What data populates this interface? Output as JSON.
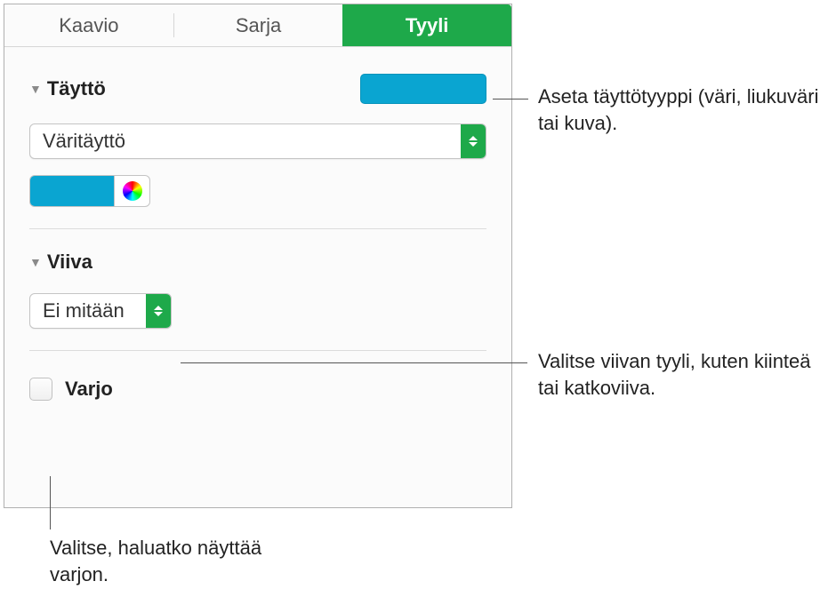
{
  "tabs": {
    "chart": "Kaavio",
    "series": "Sarja",
    "style": "Tyyli"
  },
  "fill": {
    "title": "Täyttö",
    "select_value": "Väritäyttö",
    "swatch_color": "#0aa5d1"
  },
  "line": {
    "title": "Viiva",
    "select_value": "Ei mitään"
  },
  "shadow": {
    "label": "Varjo"
  },
  "callouts": {
    "fill_type": "Aseta täyttötyyppi (väri, liukuväri tai kuva).",
    "line_style": "Valitse viivan tyyli, kuten kiinteä tai katkoviiva.",
    "shadow_check": "Valitse, haluatko näyttää varjon."
  }
}
